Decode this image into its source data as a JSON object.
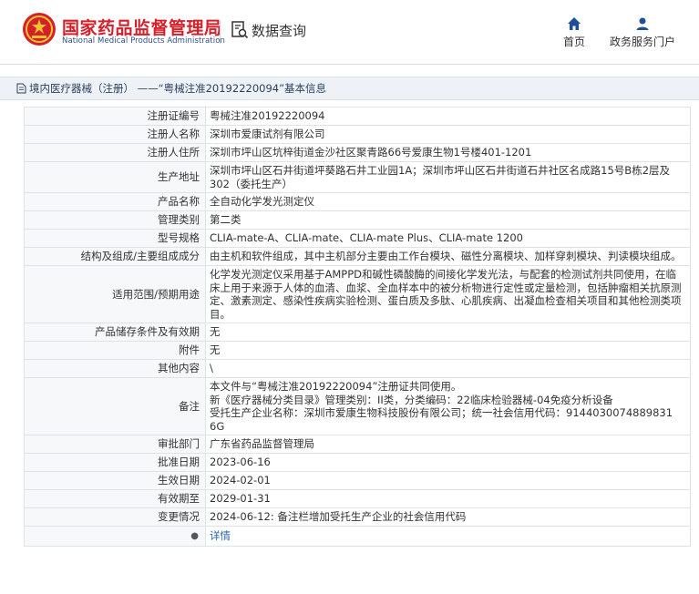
{
  "header": {
    "site_name_cn": "国家药品监督管理局",
    "site_name_en": "National Medical Products Administration",
    "query_label": "数据查询",
    "nav": [
      {
        "label": "首页",
        "icon": "home-icon"
      },
      {
        "label": "政务服务门户",
        "icon": "user-icon"
      }
    ]
  },
  "breadcrumb": "境内医疗器械（注册） ——“粤械注准20192220094”基本信息",
  "rows": [
    {
      "key": "注册证编号",
      "value": "粤械注准20192220094"
    },
    {
      "key": "注册人名称",
      "value": "深圳市爱康试剂有限公司"
    },
    {
      "key": "注册人住所",
      "value": "深圳市坪山区坑梓街道金沙社区聚青路66号爱康生物1号楼401-1201"
    },
    {
      "key": "生产地址",
      "value": "深圳市坪山区石井街道坪葵路石井工业园1A；深圳市坪山区石井街道石井社区名成路15号B栋2层及302（委托生产）"
    },
    {
      "key": "产品名称",
      "value": "全自动化学发光测定仪"
    },
    {
      "key": "管理类别",
      "value": "第二类"
    },
    {
      "key": "型号规格",
      "value": "CLIA-mate-A、CLIA-mate、CLIA-mate Plus、CLIA-mate 1200"
    },
    {
      "key": "结构及组成/主要组成成分",
      "value": "由主机和软件组成，其中主机部分主要由工作台模块、磁性分离模块、加样穿刺模块、判读模块组成。"
    },
    {
      "key": "适用范围/预期用途",
      "value": "化学发光测定仪采用基于AMPPD和碱性磷酸酶的间接化学发光法，与配套的检测试剂共同使用，在临床上用于来源于人体的血清、血浆、全血样本中的被分析物进行定性或定量检测，包括肿瘤相关抗原测定、激素测定、感染性疾病实验检测、蛋白质及多肽、心肌疾病、出凝血检查相关项目和其他检测类项目。"
    },
    {
      "key": "产品储存条件及有效期",
      "value": "无"
    },
    {
      "key": "附件",
      "value": "无"
    },
    {
      "key": "其他内容",
      "value": "\\"
    },
    {
      "key": "备注",
      "value": "本文件与“粤械注准20192220094”注册证共同使用。\n新《医疗器械分类目录》管理类别：II类，分类编码：22临床检验器械-04免疫分析设备\n受托生产企业名称：深圳市爱康生物科技股份有限公司；统一社会信用代码：9144030074889831 6G"
    },
    {
      "key": "审批部门",
      "value": "广东省药品监督管理局"
    },
    {
      "key": "批准日期",
      "value": "2023-06-16"
    },
    {
      "key": "生效日期",
      "value": "2024-02-01"
    },
    {
      "key": "有效期至",
      "value": "2029-01-31"
    },
    {
      "key": "变更情况",
      "value": "2024-06-12: 备注栏增加受托生产企业的社会信用代码"
    }
  ],
  "last_row": {
    "key_icon": "pin-icon",
    "link": "详情"
  }
}
